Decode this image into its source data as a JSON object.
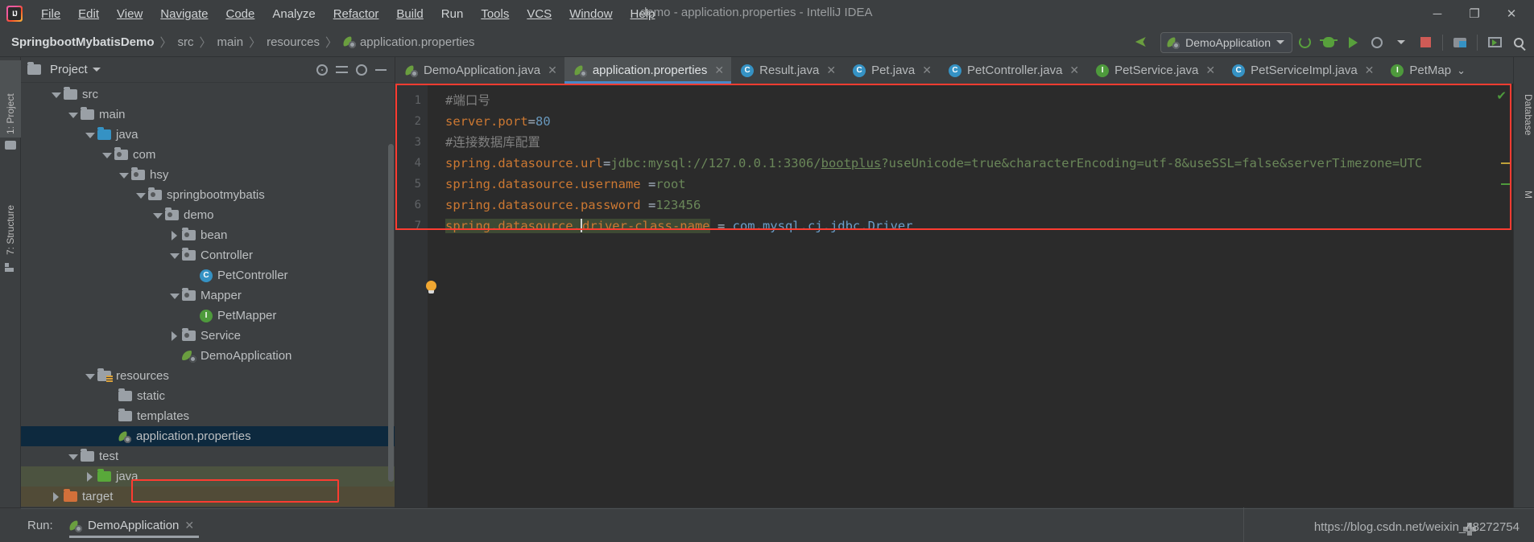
{
  "window": {
    "title": "demo - application.properties - IntelliJ IDEA",
    "logo_label": "IJ",
    "controls": {
      "minimize": "─",
      "maximize": "❐",
      "close": "✕"
    }
  },
  "menu": [
    {
      "label": "File"
    },
    {
      "label": "Edit"
    },
    {
      "label": "View"
    },
    {
      "label": "Navigate"
    },
    {
      "label": "Code"
    },
    {
      "label": "Analyze"
    },
    {
      "label": "Refactor"
    },
    {
      "label": "Build"
    },
    {
      "label": "Run"
    },
    {
      "label": "Tools"
    },
    {
      "label": "VCS"
    },
    {
      "label": "Window"
    },
    {
      "label": "Help"
    }
  ],
  "breadcrumb": {
    "separator": "〉",
    "items": [
      {
        "label": "SpringbootMybatisDemo",
        "icon": ""
      },
      {
        "label": "src",
        "icon": ""
      },
      {
        "label": "main",
        "icon": ""
      },
      {
        "label": "resources",
        "icon": ""
      },
      {
        "label": "application.properties",
        "icon": "spring-leaf-icon"
      }
    ]
  },
  "toolbar": {
    "run_configuration": "DemoApplication",
    "run_config_caret": "▾",
    "buttons": [
      {
        "name": "build-hammer-button",
        "label": ""
      },
      {
        "name": "rerun-button",
        "label": ""
      },
      {
        "name": "debug-button",
        "label": ""
      },
      {
        "name": "run-with-coverage-button",
        "label": ""
      },
      {
        "name": "profiler-button",
        "label": ""
      },
      {
        "name": "stop-button",
        "label": ""
      },
      {
        "name": "project-structure-button",
        "label": ""
      },
      {
        "name": "run-anything-button",
        "label": ""
      },
      {
        "name": "search-everywhere-button",
        "label": ""
      }
    ]
  },
  "left_strip": [
    {
      "label": "1: Project",
      "icon": "folder-icon",
      "selected": true
    },
    {
      "label": "7: Structure",
      "icon": "structure-icon",
      "selected": false
    }
  ],
  "right_strip": [
    {
      "label": "Database",
      "icon": "database-icon"
    },
    {
      "label": "M",
      "icon": "maven-icon"
    }
  ],
  "project_panel": {
    "title": "Project",
    "title_caret": "▾",
    "header_icons": [
      {
        "name": "locate-file-icon"
      },
      {
        "name": "collapse-all-icon"
      },
      {
        "name": "settings-gear-icon"
      },
      {
        "name": "hide-panel-icon"
      }
    ],
    "tree": [
      {
        "label": "src",
        "depth": 1,
        "arrow": "down",
        "icon": "folder",
        "state": ""
      },
      {
        "label": "main",
        "depth": 2,
        "arrow": "down",
        "icon": "folder",
        "state": ""
      },
      {
        "label": "java",
        "depth": 3,
        "arrow": "down",
        "icon": "folder-blue",
        "state": ""
      },
      {
        "label": "com",
        "depth": 4,
        "arrow": "down",
        "icon": "package",
        "state": ""
      },
      {
        "label": "hsy",
        "depth": 5,
        "arrow": "down",
        "icon": "package",
        "state": ""
      },
      {
        "label": "springbootmybatis",
        "depth": 6,
        "arrow": "down",
        "icon": "package",
        "state": ""
      },
      {
        "label": "demo",
        "depth": 7,
        "arrow": "down",
        "icon": "package",
        "state": ""
      },
      {
        "label": "bean",
        "depth": 8,
        "arrow": "right",
        "icon": "package",
        "state": ""
      },
      {
        "label": "Controller",
        "depth": 8,
        "arrow": "down",
        "icon": "package",
        "state": ""
      },
      {
        "label": "PetController",
        "depth": 9,
        "arrow": "none",
        "icon": "class",
        "state": ""
      },
      {
        "label": "Mapper",
        "depth": 8,
        "arrow": "down",
        "icon": "package",
        "state": ""
      },
      {
        "label": "PetMapper",
        "depth": 9,
        "arrow": "none",
        "icon": "interface",
        "state": ""
      },
      {
        "label": "Service",
        "depth": 8,
        "arrow": "right",
        "icon": "package",
        "state": ""
      },
      {
        "label": "DemoApplication",
        "depth": 8,
        "arrow": "none",
        "icon": "spring-run",
        "state": ""
      },
      {
        "label": "resources",
        "depth": 3,
        "arrow": "down",
        "icon": "folder-res",
        "state": ""
      },
      {
        "label": "static",
        "depth": 4,
        "arrow": "none",
        "icon": "folder",
        "state": ""
      },
      {
        "label": "templates",
        "depth": 4,
        "arrow": "none",
        "icon": "folder",
        "state": ""
      },
      {
        "label": "application.properties",
        "depth": 4,
        "arrow": "none",
        "icon": "spring-leaf",
        "state": "selected"
      },
      {
        "label": "test",
        "depth": 2,
        "arrow": "down",
        "icon": "folder",
        "state": ""
      },
      {
        "label": "java",
        "depth": 3,
        "arrow": "right",
        "icon": "folder-green",
        "state": "ctx-green"
      },
      {
        "label": "target",
        "depth": 1,
        "arrow": "right",
        "icon": "folder-orange",
        "state": "ctx-brown"
      }
    ]
  },
  "editor_tabs": [
    {
      "label": "DemoApplication.java",
      "icon": "spring-leaf-icon",
      "active": false,
      "close": "✕"
    },
    {
      "label": "application.properties",
      "icon": "spring-leaf-icon",
      "active": true,
      "close": "✕"
    },
    {
      "label": "Result.java",
      "icon": "class-icon",
      "active": false,
      "close": "✕"
    },
    {
      "label": "Pet.java",
      "icon": "class-icon",
      "active": false,
      "close": "✕"
    },
    {
      "label": "PetController.java",
      "icon": "class-icon",
      "active": false,
      "close": "✕"
    },
    {
      "label": "PetService.java",
      "icon": "interface-icon",
      "active": false,
      "close": "✕"
    },
    {
      "label": "PetServiceImpl.java",
      "icon": "class-icon",
      "active": false,
      "close": "✕"
    },
    {
      "label": "PetMap",
      "icon": "interface-icon",
      "active": false,
      "close": "⌄"
    }
  ],
  "editor": {
    "line_numbers": [
      "1",
      "2",
      "3",
      "4",
      "5",
      "6",
      "7"
    ],
    "inspection_ok_icon": "✔",
    "lines": {
      "l1_comment": "#端口号",
      "l2_key": "server.port",
      "l2_eq": "=",
      "l2_val": "80",
      "l3_comment": "#连接数据库配置",
      "l4_key": "spring.datasource.url",
      "l4_eq": "=",
      "l4_val_a": "jdbc:mysql://127.0.0.1:3306/",
      "l4_val_link": "bootplus",
      "l4_val_b": "?useUnicode=true&characterEncoding=utf-8&useSSL=false&serverTimezone=UTC",
      "l5_key": "spring.datasource.username ",
      "l5_eq": "=",
      "l5_val": "root",
      "l6_key": "spring.datasource.password ",
      "l6_eq": "=",
      "l6_val": "123456",
      "l7_key_a": "spring.datasource.",
      "l7_key_b": "driver-class-name",
      "l7_eq": " = ",
      "l7_val": "com.mysql.cj.jdbc.Driver"
    }
  },
  "bottom": {
    "run_label": "Run:",
    "run_tab": "DemoApplication",
    "run_tab_close": "✕",
    "watermark": "https://blog.csdn.net/weixin_48272754"
  },
  "colors": {
    "accent_blue": "#4a88c7",
    "highlight_red": "#fd3c31",
    "selection_navy": "#0d293e",
    "spring_green": "#6a9e3f",
    "editor_bg": "#2b2b2b",
    "panel_bg": "#3c3f41"
  }
}
